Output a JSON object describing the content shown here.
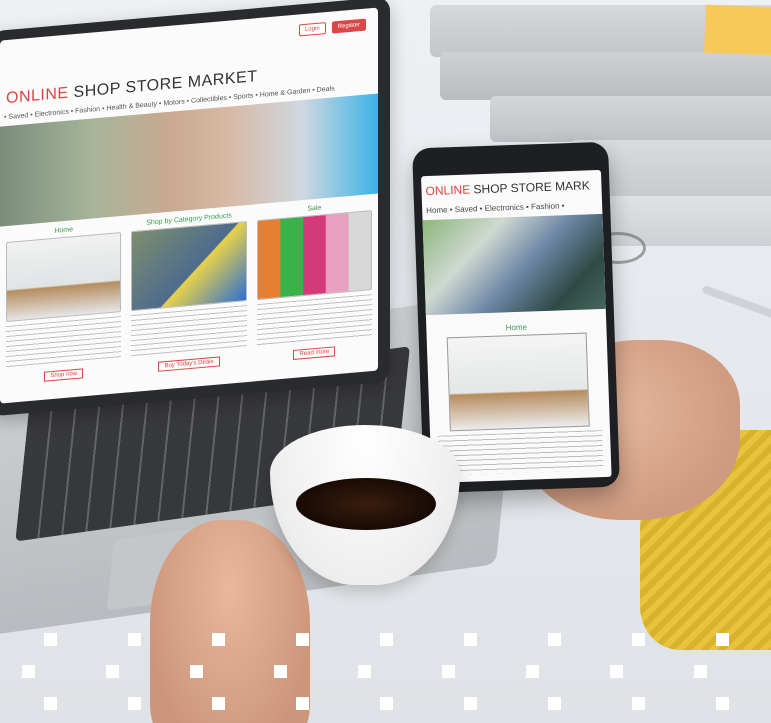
{
  "scene": {
    "description_colors": {
      "accent": "#e04242",
      "green": "#3c9a4f",
      "sleeve": "#e7c43b"
    }
  },
  "laptop_site": {
    "brand_red": "ONLINE",
    "brand_rest": " SHOP STORE MARKET",
    "nav": "• Saved • Electronics • Fashion • Health & Beauty • Motors • Collectibles • Sports • Home & Garden • Deals",
    "top_buttons": [
      "Login",
      "Register"
    ],
    "columns": [
      {
        "title": "Home",
        "button": "Shop now"
      },
      {
        "title": "Shop by Category Products",
        "button": "Buy Today's Deals"
      },
      {
        "title": "Sale",
        "button": "Read more"
      }
    ]
  },
  "phone_site": {
    "brand_red": "ONLINE",
    "brand_rest": " SHOP STORE MARK",
    "nav": "Home • Saved • Electronics • Fashion •",
    "section_title": "Home"
  }
}
